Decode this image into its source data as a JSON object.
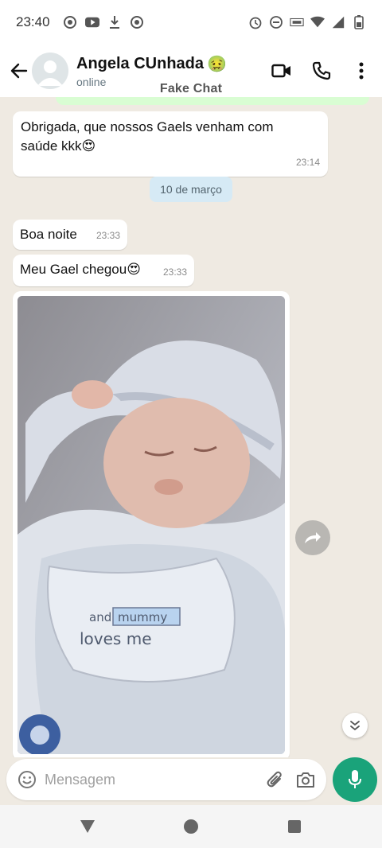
{
  "status_bar": {
    "time": "23:40",
    "left_icons": [
      "focus-icon",
      "youtube-icon",
      "download-icon",
      "focus-icon"
    ],
    "right_icons": [
      "alarm-icon",
      "dnd-icon",
      "volte-icon",
      "wifi-icon",
      "signal-5g-icon",
      "battery-icon"
    ]
  },
  "header": {
    "contact_name": "Angela CUnhada",
    "contact_emoji": "🤢",
    "status": "online",
    "watermark": "Fake Chat"
  },
  "messages": [
    {
      "text": "Obrigada, que nossos Gaels venham com saúde kkk😍",
      "time": "23:14"
    },
    {
      "date_divider": "10 de março"
    },
    {
      "text": "Boa noite",
      "time": "23:33"
    },
    {
      "text": "Meu Gael chegou😍",
      "time": "23:33"
    },
    {
      "type": "image",
      "caption_printed": "and mummy loves me"
    }
  ],
  "composer": {
    "placeholder": "Mensagem"
  },
  "colors": {
    "accent": "#1aa37a",
    "chat_bg": "#efeae2",
    "date_chip": "#d6eaf5",
    "outgoing_bubble": "#d9fdd3"
  }
}
